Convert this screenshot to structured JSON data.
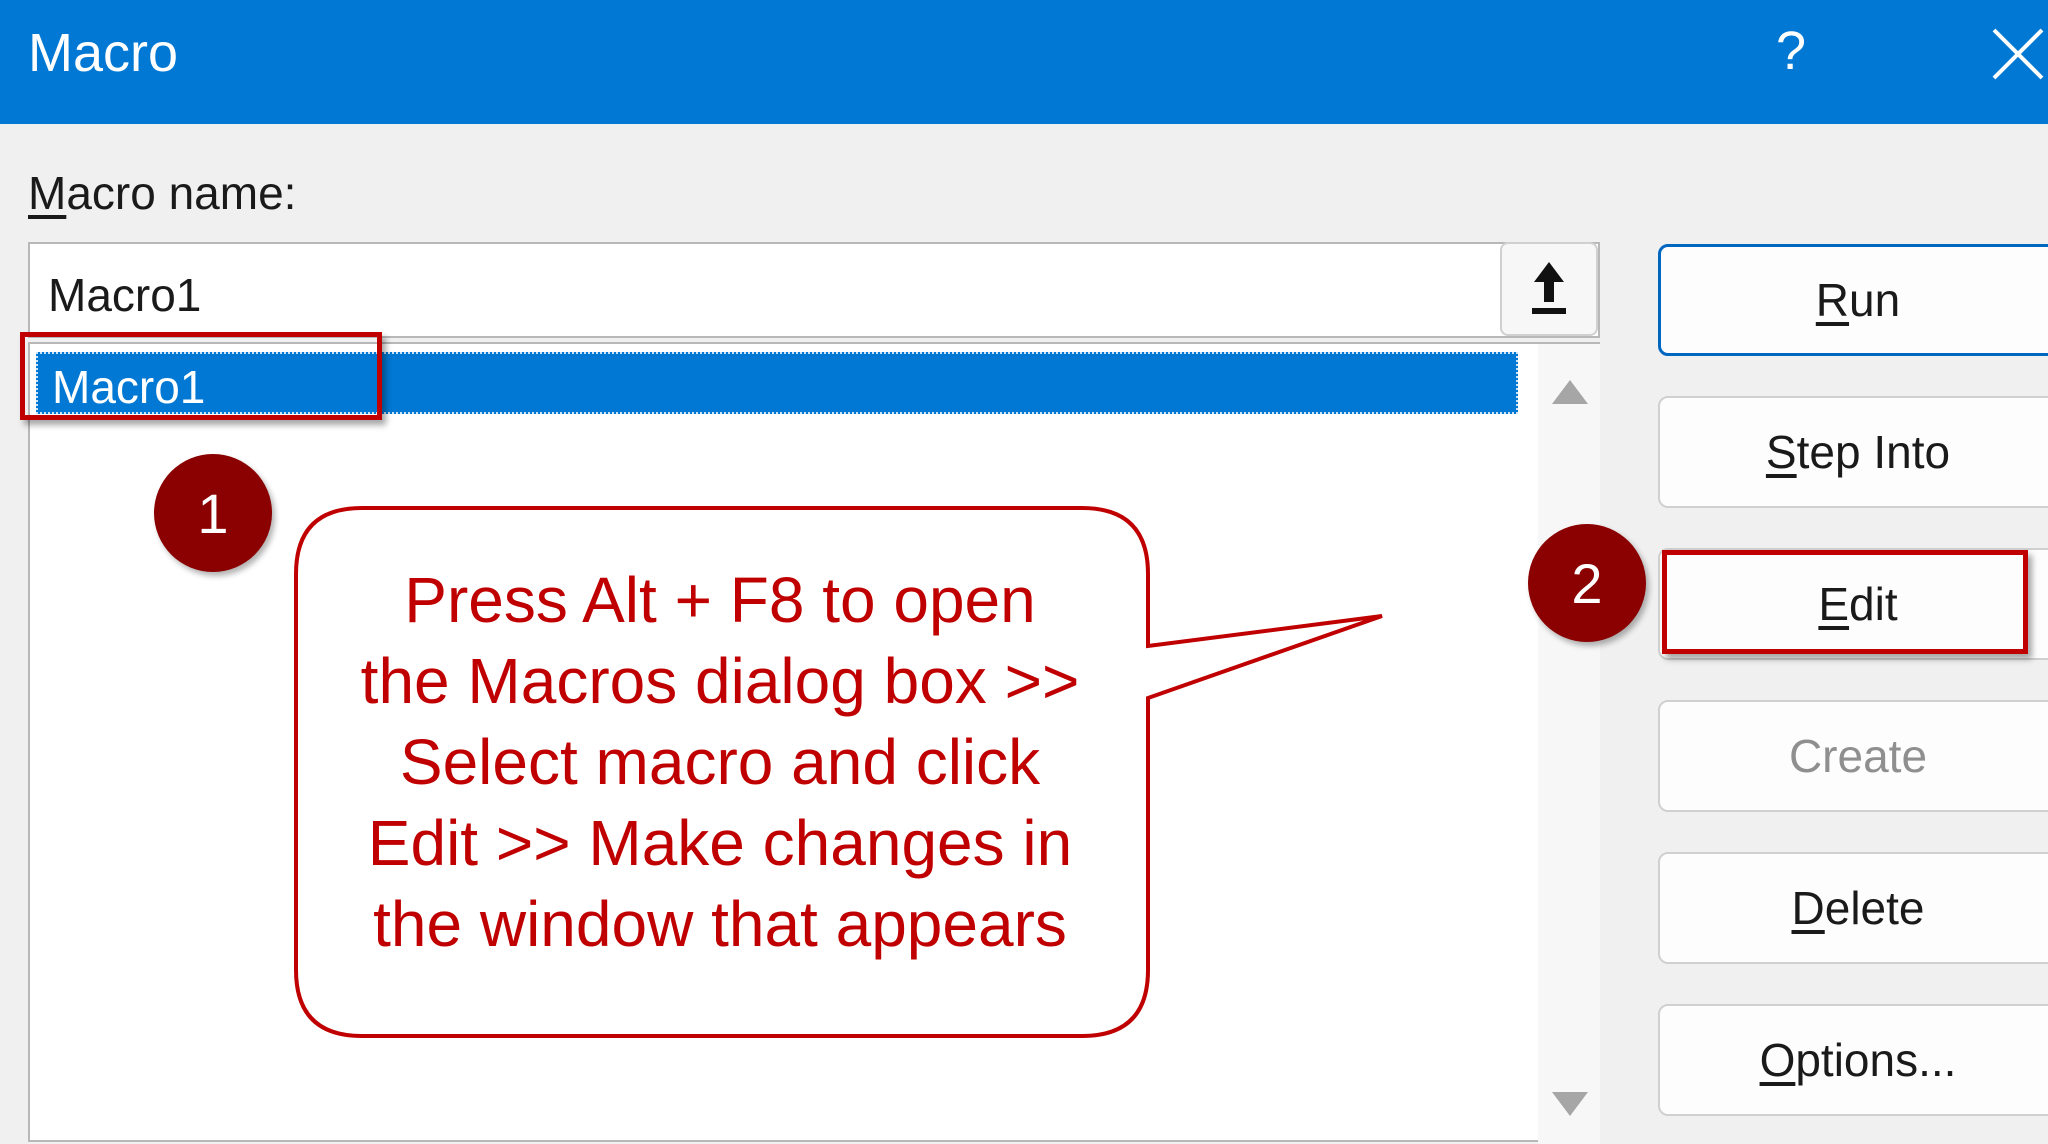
{
  "window": {
    "title": "Macro",
    "help_glyph": "?"
  },
  "macro_name": {
    "label_mnemonic": "M",
    "label_rest": "acro name:",
    "value": "Macro1"
  },
  "macro_list": {
    "items": [
      {
        "label": "Macro1",
        "selected": true
      }
    ]
  },
  "buttons": {
    "run": {
      "mnemonic": "R",
      "rest": "un"
    },
    "step_into": {
      "mnemonic": "S",
      "rest": "tep Into"
    },
    "edit": {
      "mnemonic": "E",
      "rest": "dit"
    },
    "create": {
      "label": "Create",
      "disabled": true
    },
    "delete": {
      "mnemonic": "D",
      "rest": "elete"
    },
    "options": {
      "mnemonic": "O",
      "rest": "ptions..."
    }
  },
  "annotations": {
    "step1": "1",
    "step2": "2",
    "callout_lines": [
      "Press Alt + F8 to open",
      "the Macros dialog box >>",
      "Select macro and click",
      "Edit >> Make changes in",
      "the window that appears"
    ]
  },
  "icons": {
    "collapse": "collapse-dialog-icon",
    "close": "close-icon",
    "help": "help-icon",
    "scroll_up": "scroll-up-arrow-icon",
    "scroll_down": "scroll-down-arrow-icon"
  },
  "colors": {
    "titlebar": "#0078d4",
    "selection": "#0078d4",
    "annotation_red": "#c00000",
    "badge": "#8b0000"
  }
}
